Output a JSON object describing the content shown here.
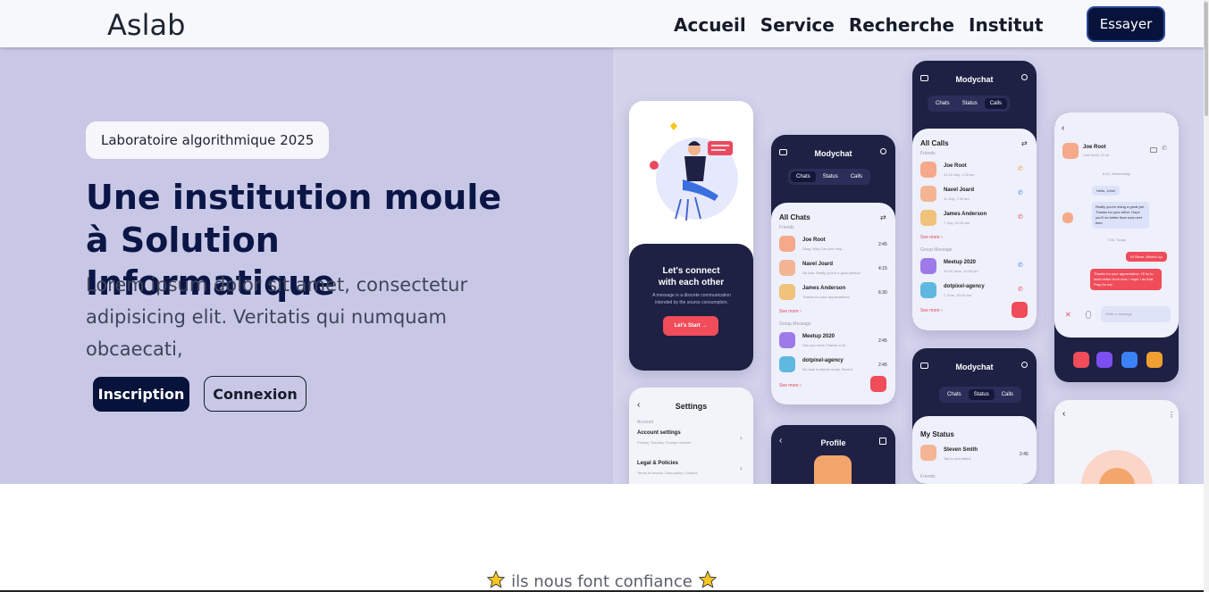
{
  "navbar": {
    "brand": "Aslab",
    "links": [
      "Accueil",
      "Service",
      "Recherche",
      "Institut"
    ],
    "cta": "Essayer"
  },
  "hero": {
    "badge": "Laboratoire algorithmique 2025",
    "title": "Une institution moule à Solution Informatique",
    "text": "Lorem ipsum dolor sit amet, consectetur adipisicing elit. Veritatis qui numquam obcaecati,",
    "signup": "Inscription",
    "login": "Connexion"
  },
  "mockups": {
    "app_name": "Modychat",
    "connect_title": "Let's connect with each other",
    "connect_sub": "A message is a discrete communication intended by the source consumption.",
    "start_btn": "Let's Start  →",
    "tabs": [
      "Chats",
      "Status",
      "Calls"
    ],
    "all_chats": "All Chats",
    "all_calls": "All Calls",
    "friends": "Friends",
    "group_message": "Group Message",
    "see_more": "See more ›",
    "chats": [
      {
        "name": "Joe Root",
        "sub": "Okay, Why Can you help...",
        "time": "2:45"
      },
      {
        "name": "Navel Joard",
        "sub": "Na ada. Really you're a good person",
        "time": "4:15"
      },
      {
        "name": "James Anderson",
        "sub": "Thanks for your appreciations",
        "time": "6:30"
      }
    ],
    "groups": [
      {
        "name": "Meetup 2020",
        "sub": "See you mock Thanks a lot",
        "time": "2:45"
      },
      {
        "name": "dotpixel-agency",
        "sub": "My task is almost ready. Send it",
        "time": "2:45"
      }
    ],
    "calls": [
      {
        "name": "Joe Root",
        "sub": "12:15 July, 1:00 am"
      },
      {
        "name": "Navel Joard",
        "sub": "11 July, 7:30 am"
      },
      {
        "name": "James Anderson",
        "sub": "7 July, 10:15 am"
      }
    ],
    "call_groups": [
      {
        "name": "Meetup 2020",
        "sub": "10:15 June, 12:00 pm"
      },
      {
        "name": "dotpixel-agency",
        "sub": "7 June, 10:15 am"
      }
    ],
    "settings_title": "Settings",
    "account": "Account",
    "account_settings": "Account settings",
    "account_settings_sub": "Privacy, Security, Change number",
    "legal": "Legal & Policies",
    "legal_sub": "Terms of service, Data policy, Cookies",
    "profile_title": "Profile",
    "my_status": "My Status",
    "status_name": "Steven Smith",
    "status_sub": "Tap to add status",
    "status_time": "2:45",
    "convo_name": "Joe Root",
    "convo_sub": "Last Seen 12:45",
    "convo_day1": "8:30, Wednesday",
    "msg1": "Hello, John!",
    "msg2": "Really you're doing a great job. Thanks for your effort. Hope you'll do better than now next time.",
    "convo_day2": "7:00, Today",
    "msg3": "Hi Steve, What's Up",
    "msg4": "Thanks for your appreciation. I'll try to work better from now. I hope I do that. Pray for me.",
    "write_msg": "Write a message"
  },
  "trust": {
    "text": "ils nous font confiance"
  }
}
